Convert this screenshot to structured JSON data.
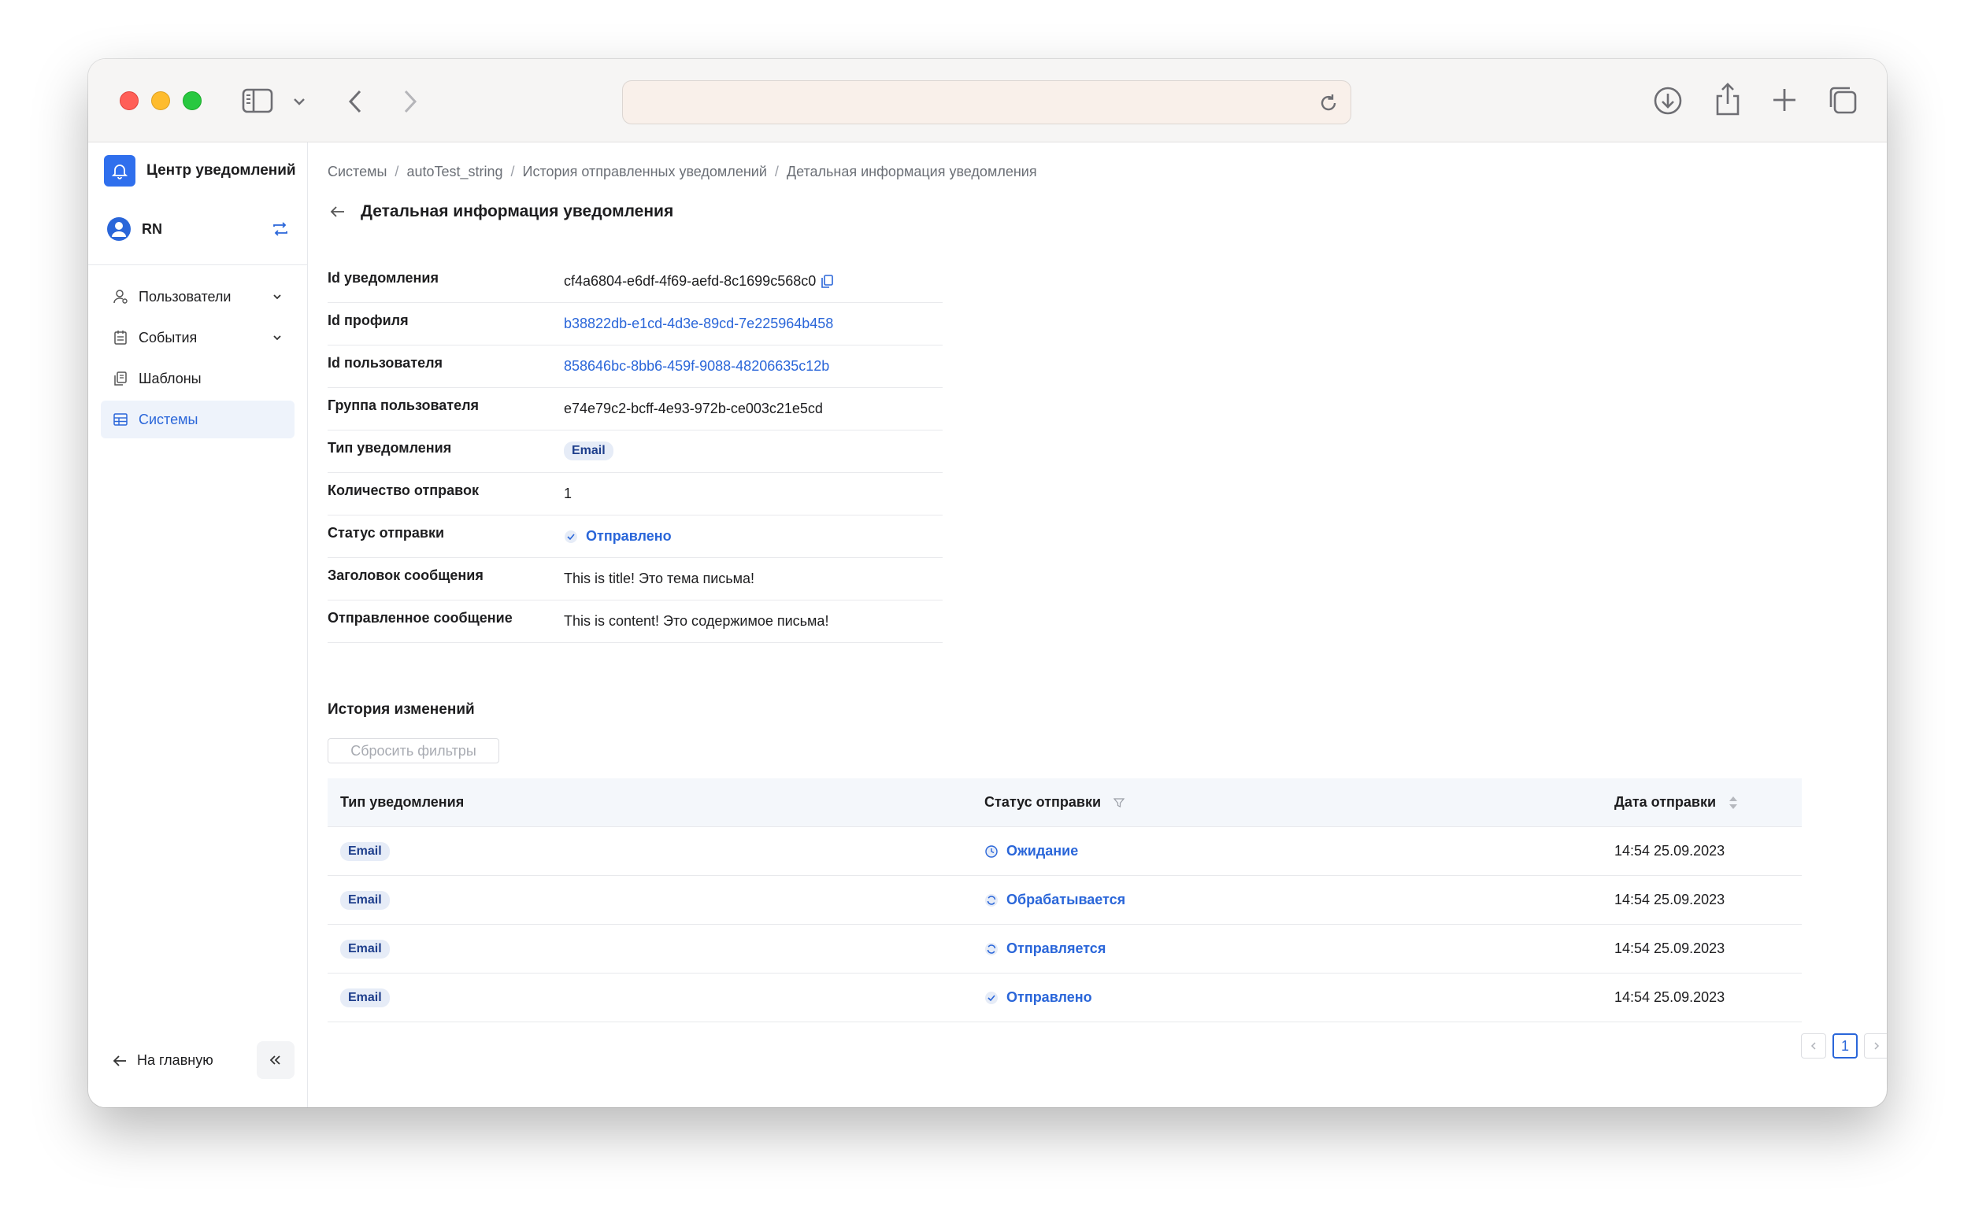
{
  "app": {
    "title": "Центр уведомлений",
    "user": "RN"
  },
  "sidebar": {
    "items": [
      {
        "label": "Пользователи",
        "icon": "user-icon",
        "expandable": true
      },
      {
        "label": "События",
        "icon": "calendar-icon",
        "expandable": true
      },
      {
        "label": "Шаблоны",
        "icon": "copy-icon",
        "expandable": false
      },
      {
        "label": "Системы",
        "icon": "systems-icon",
        "expandable": false,
        "active": true
      }
    ],
    "home_label": "На главную"
  },
  "breadcrumb": [
    "Системы",
    "autoTest_string",
    "История отправленных уведомлений",
    "Детальная информация уведомления"
  ],
  "page": {
    "title": "Детальная информация уведомления"
  },
  "details": {
    "notification_id": {
      "label": "Id уведомления",
      "value": "cf4a6804-e6df-4f69-aefd-8c1699c568c0"
    },
    "profile_id": {
      "label": "Id профиля",
      "value": "b38822db-e1cd-4d3e-89cd-7e225964b458"
    },
    "user_id": {
      "label": "Id пользователя",
      "value": "858646bc-8bb6-459f-9088-48206635c12b"
    },
    "user_group": {
      "label": "Группа пользователя",
      "value": "e74e79c2-bcff-4e93-972b-ce003c21e5cd"
    },
    "type": {
      "label": "Тип уведомления",
      "value": "Email"
    },
    "send_count": {
      "label": "Количество отправок",
      "value": "1"
    },
    "status": {
      "label": "Статус отправки",
      "value": "Отправлено"
    },
    "subject": {
      "label": "Заголовок сообщения",
      "value": "This is title! Это тема письма!"
    },
    "message": {
      "label": "Отправленное сообщение",
      "value": "This is content! Это содержимое письма!"
    }
  },
  "history": {
    "title": "История изменений",
    "reset_label": "Сбросить фильтры",
    "columns": [
      "Тип уведомления",
      "Статус отправки",
      "Дата отправки"
    ],
    "rows": [
      {
        "type": "Email",
        "status": "Ожидание",
        "status_icon": "clock-icon",
        "date": "14:54 25.09.2023"
      },
      {
        "type": "Email",
        "status": "Обрабатывается",
        "status_icon": "sync-icon",
        "date": "14:54 25.09.2023"
      },
      {
        "type": "Email",
        "status": "Отправляется",
        "status_icon": "sync-icon",
        "date": "14:54 25.09.2023"
      },
      {
        "type": "Email",
        "status": "Отправлено",
        "status_icon": "check-icon",
        "date": "14:54 25.09.2023"
      }
    ],
    "pagination": {
      "current": "1"
    }
  },
  "colors": {
    "accent": "#2a66d9",
    "brand": "#2f6fed"
  }
}
